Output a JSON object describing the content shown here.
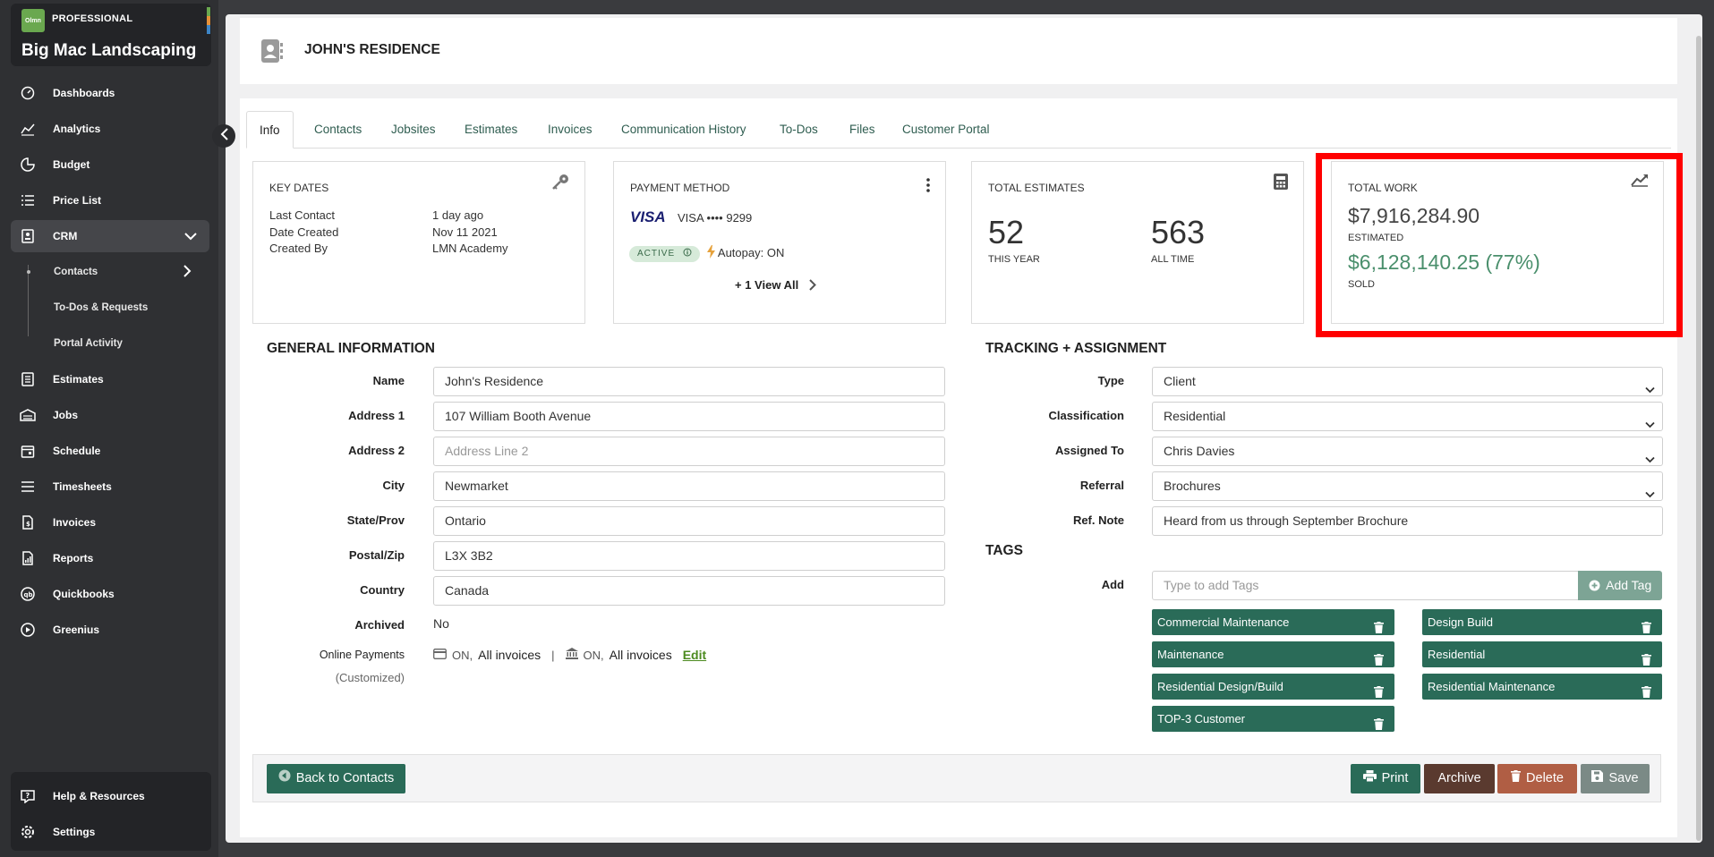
{
  "brand": {
    "logo_text": "Olmn",
    "tier": "PROFESSIONAL",
    "company": "Big Mac Landscaping"
  },
  "sidebar": {
    "items": [
      {
        "label": "Dashboards",
        "icon": "dashboard-icon"
      },
      {
        "label": "Analytics",
        "icon": "analytics-icon"
      },
      {
        "label": "Budget",
        "icon": "budget-icon"
      },
      {
        "label": "Price List",
        "icon": "list-icon"
      },
      {
        "label": "CRM",
        "icon": "crm-icon"
      },
      {
        "label": "Estimates",
        "icon": "estimates-icon"
      },
      {
        "label": "Jobs",
        "icon": "jobs-icon"
      },
      {
        "label": "Schedule",
        "icon": "calendar-icon"
      },
      {
        "label": "Timesheets",
        "icon": "timesheets-icon"
      },
      {
        "label": "Invoices",
        "icon": "invoice-icon"
      },
      {
        "label": "Reports",
        "icon": "reports-icon"
      },
      {
        "label": "Quickbooks",
        "icon": "quickbooks-icon"
      },
      {
        "label": "Greenius",
        "icon": "play-icon"
      }
    ],
    "crm_sub": [
      "Contacts",
      "To-Dos & Requests",
      "Portal Activity"
    ],
    "bottom": [
      "Help & Resources",
      "Settings"
    ]
  },
  "header": {
    "title": "JOHN'S RESIDENCE"
  },
  "tabs": [
    "Info",
    "Contacts",
    "Jobsites",
    "Estimates",
    "Invoices",
    "Communication History",
    "To-Dos",
    "Files",
    "Customer Portal"
  ],
  "key_dates": {
    "title": "KEY DATES",
    "rows": [
      {
        "label": "Last Contact",
        "value": "1 day ago"
      },
      {
        "label": "Date Created",
        "value": "Nov 11 2021"
      },
      {
        "label": "Created By",
        "value": "LMN Academy"
      }
    ]
  },
  "payment": {
    "title": "PAYMENT METHOD",
    "card_brand": "VISA",
    "card_text": "VISA •••• 9299",
    "status": "ACTIVE",
    "autopay": "Autopay: ON",
    "view_all": "+ 1 View All"
  },
  "estimates": {
    "title": "TOTAL ESTIMATES",
    "this_year": "52",
    "this_year_label": "THIS YEAR",
    "all_time": "563",
    "all_time_label": "ALL TIME"
  },
  "total_work": {
    "title": "TOTAL WORK",
    "estimated": "$7,916,284.90",
    "estimated_label": "ESTIMATED",
    "sold": "$6,128,140.25 (77%)",
    "sold_label": "SOLD"
  },
  "general": {
    "title": "GENERAL INFORMATION",
    "fields": [
      {
        "label": "Name",
        "value": "John's Residence",
        "placeholder": ""
      },
      {
        "label": "Address 1",
        "value": "107 William Booth Avenue",
        "placeholder": ""
      },
      {
        "label": "Address 2",
        "value": "",
        "placeholder": "Address Line 2"
      },
      {
        "label": "City",
        "value": "Newmarket",
        "placeholder": ""
      },
      {
        "label": "State/Prov",
        "value": "Ontario",
        "placeholder": ""
      },
      {
        "label": "Postal/Zip",
        "value": "L3X 3B2",
        "placeholder": ""
      },
      {
        "label": "Country",
        "value": "Canada",
        "placeholder": ""
      }
    ],
    "archived_label": "Archived",
    "archived_value": "No",
    "online_label": "Online Payments",
    "online_sub": "(Customized)",
    "online_on1": "ON,",
    "online_val1": "All invoices",
    "online_sep": "|",
    "online_on2": "ON,",
    "online_val2": "All invoices",
    "edit": "Edit"
  },
  "tracking": {
    "title": "TRACKING + ASSIGNMENT",
    "fields": [
      {
        "label": "Type",
        "value": "Client"
      },
      {
        "label": "Classification",
        "value": "Residential"
      },
      {
        "label": "Assigned To",
        "value": "Chris Davies"
      },
      {
        "label": "Referral",
        "value": "Brochures"
      }
    ],
    "ref_label": "Ref. Note",
    "ref_value": "Heard from us through September Brochure"
  },
  "tags": {
    "title": "TAGS",
    "add_label": "Add",
    "placeholder": "Type to add Tags",
    "add_button": "Add Tag",
    "items": [
      "Commercial Maintenance",
      "Design Build",
      "Maintenance",
      "Residential",
      "Residential Design/Build",
      "Residential Maintenance",
      "TOP-3 Customer"
    ]
  },
  "footer": {
    "back": "Back to Contacts",
    "print": "Print",
    "archive": "Archive",
    "delete": "Delete",
    "save": "Save"
  },
  "colors": {
    "primary_green": "#2a6b58",
    "sold_green": "#4a8f6c",
    "highlight_red": "#ff0000",
    "archive_brown": "#5a3a2f",
    "delete_orange": "#b05e44",
    "save_gray": "#7b8a86"
  }
}
